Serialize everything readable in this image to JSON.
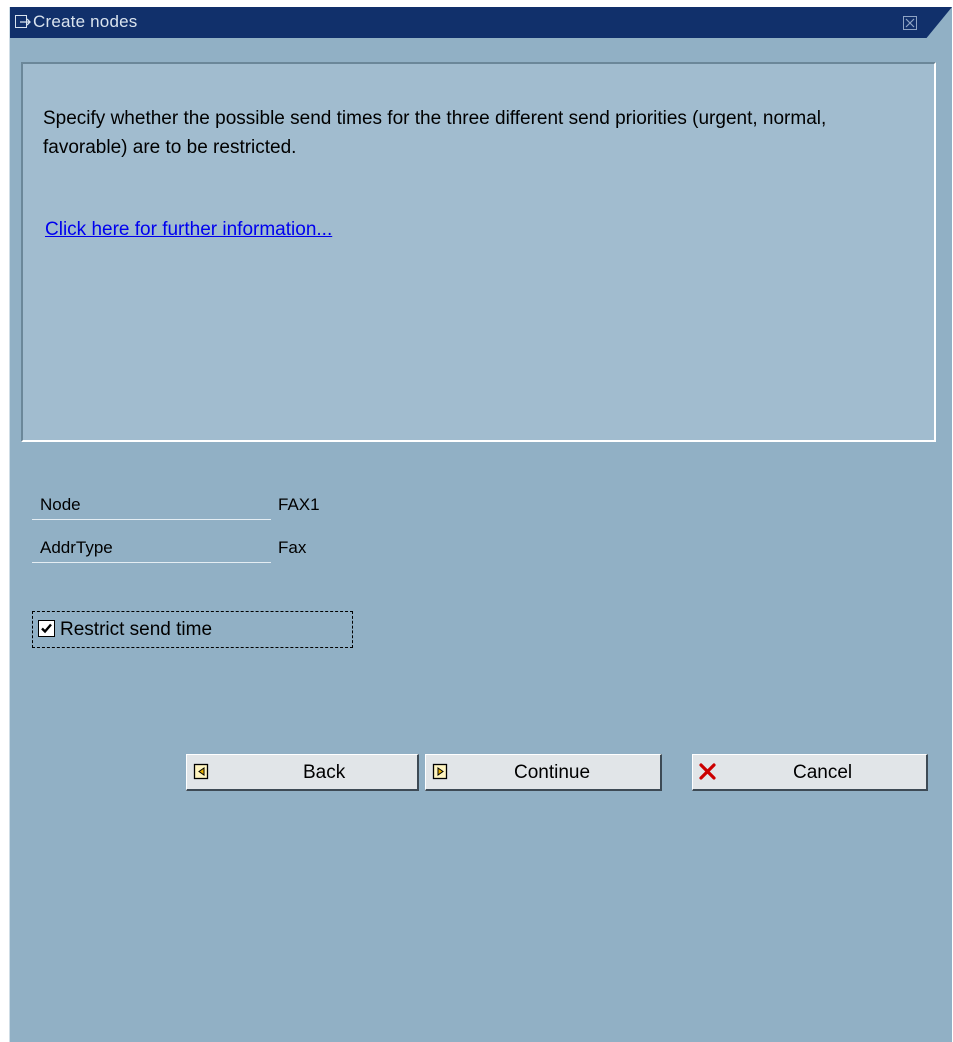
{
  "window": {
    "title": "Create nodes",
    "title_icon": "dialog-icon",
    "close_icon": "close-icon"
  },
  "info": {
    "text": "Specify whether the possible send times for the three different send priorities (urgent, normal, favorable) are to be restricted.",
    "link": "Click here for further information..."
  },
  "fields": [
    {
      "label": "Node",
      "value": "FAX1"
    },
    {
      "label": "AddrType",
      "value": "Fax"
    }
  ],
  "checkbox": {
    "label": "Restrict send time",
    "checked": true
  },
  "buttons": {
    "back": {
      "label": "Back",
      "icon": "back-page-icon"
    },
    "continue": {
      "label": "Continue",
      "icon": "continue-page-icon"
    },
    "cancel": {
      "label": "Cancel",
      "icon": "cancel-x-icon"
    }
  },
  "colors": {
    "titlebar": "#11306b",
    "background": "#91b0c5",
    "info_box": "#a1bccf",
    "link": "#0000ee",
    "cancel_x": "#cc0000"
  }
}
